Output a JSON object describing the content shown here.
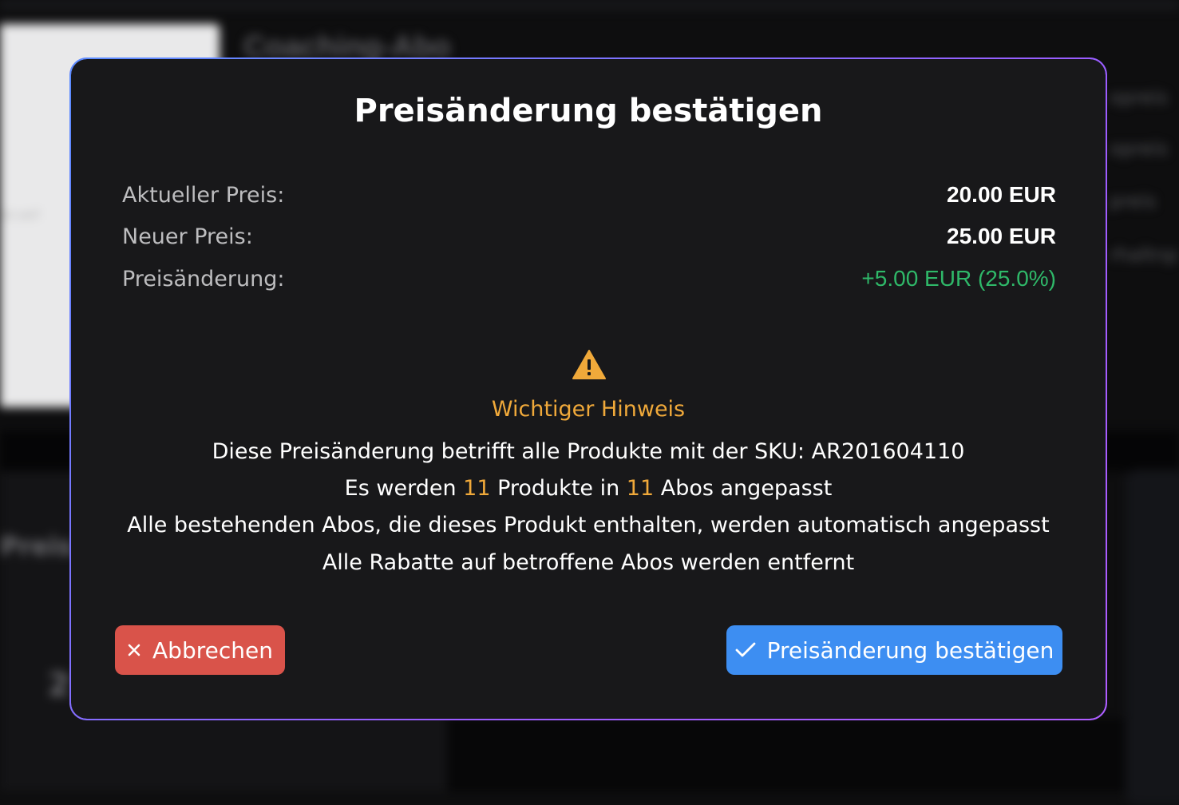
{
  "background": {
    "page_title": "Coaching-Abo",
    "card_text": "Ist verf",
    "right_items": [
      "opreis",
      "opreis",
      "preis",
      "rhaltnp"
    ],
    "lower_left_label": "Preis",
    "lower_left_value": "2"
  },
  "modal": {
    "title": "Preisänderung bestätigen",
    "rows": [
      {
        "label": "Aktueller Preis:",
        "value": "20.00 EUR"
      },
      {
        "label": "Neuer Preis:",
        "value": "25.00 EUR"
      },
      {
        "label": "Preisänderung:",
        "value": "+5.00 EUR (25.0%)"
      }
    ],
    "warning": {
      "icon": "warning-triangle-icon",
      "title": "Wichtiger Hinweis",
      "sku_line": "Diese Preisänderung betrifft alle Produkte mit der SKU: AR201604110",
      "count_prefix": "Es werden ",
      "product_count": "11",
      "count_middle": " Produkte in ",
      "abo_count": "11",
      "count_suffix": " Abos angepasst",
      "line_abos": "Alle bestehenden Abos, die dieses Produkt enthalten, werden automatisch angepasst",
      "line_discounts": "Alle Rabatte auf betroffene Abos werden entfernt"
    },
    "buttons": {
      "cancel_label": "Abbrechen",
      "cancel_icon": "close-icon",
      "confirm_label": "Preisänderung bestätigen",
      "confirm_icon": "check-icon"
    }
  },
  "colors": {
    "modal_bg": "#18181a",
    "border": "#7c6cf0",
    "accent_warning": "#f0a93a",
    "positive": "#2fb869",
    "cancel": "#d9534a",
    "confirm": "#3d8ef2"
  }
}
